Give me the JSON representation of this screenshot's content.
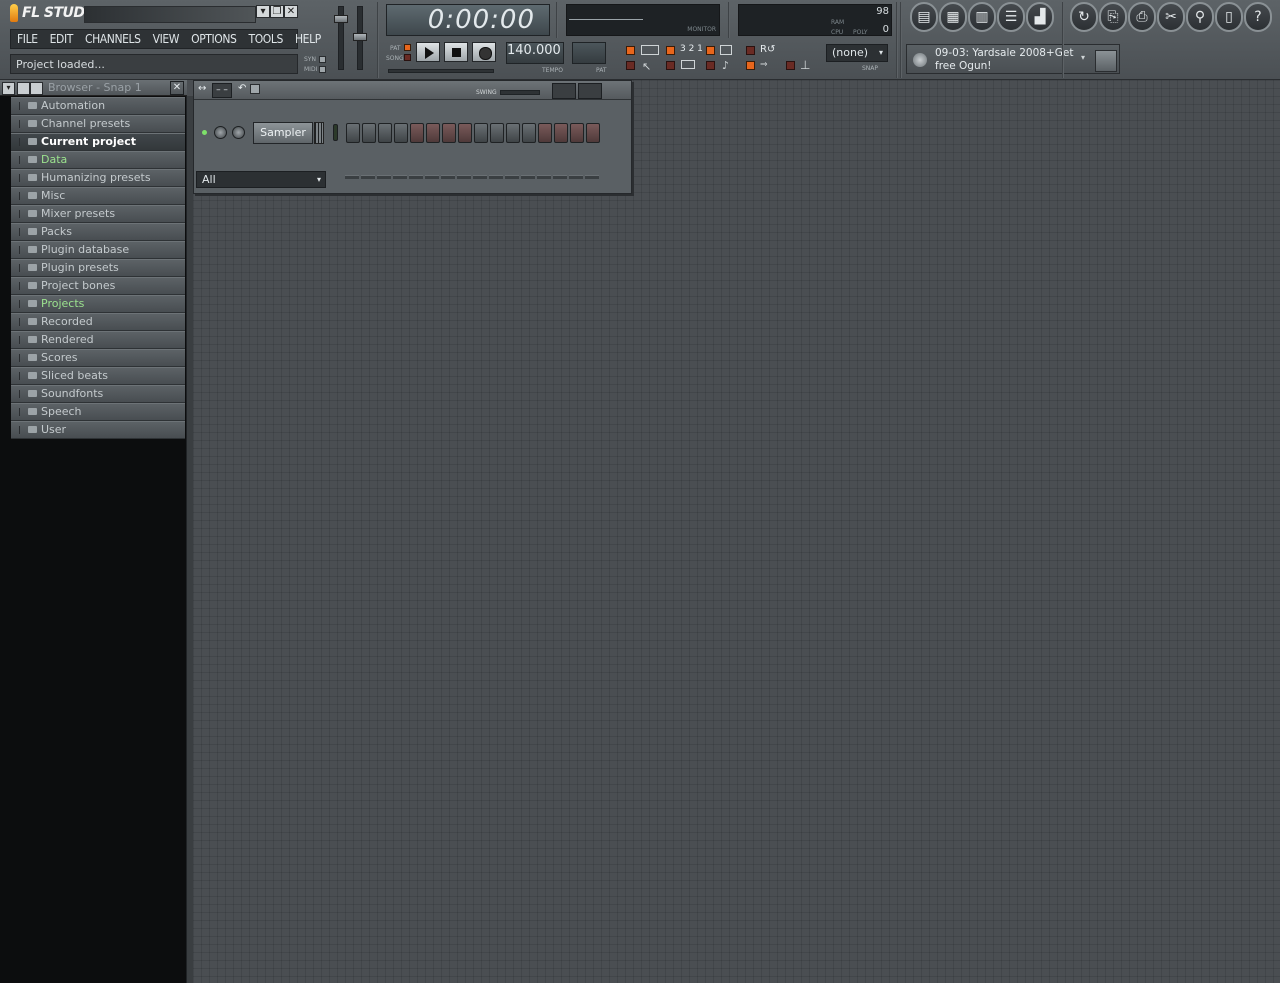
{
  "app": {
    "name": "FL STUDIO",
    "menu": [
      "FILE",
      "EDIT",
      "CHANNELS",
      "VIEW",
      "OPTIONS",
      "TOOLS",
      "HELP"
    ],
    "hint": "Project loaded...",
    "window_buttons": [
      "▾",
      "❐",
      "✕"
    ]
  },
  "transport": {
    "time": "0:00:00",
    "tempo": "140.000",
    "tempo_label": "TEMPO",
    "pat_label": "PAT",
    "mode_labels": [
      "PAT",
      "SONG"
    ],
    "syn_label": "SYN",
    "midi_label": "MIDI",
    "monitor_label": "MONITOR"
  },
  "meters": {
    "ram_label": "RAM",
    "cpu_label": "CPU",
    "poly_label": "POLY",
    "ram_value": "98",
    "poly_value": "0"
  },
  "snap": {
    "value": "(none)",
    "label": "SNAP"
  },
  "news": {
    "text_line1": "09-03: Yardsale 2008+Get",
    "text_line2": "free Ogun!"
  },
  "browser": {
    "title": "Browser - Snap 1",
    "items": [
      {
        "label": "Automation",
        "state": "normal"
      },
      {
        "label": "Channel presets",
        "state": "normal"
      },
      {
        "label": "Current project",
        "state": "selected"
      },
      {
        "label": "Data",
        "state": "green"
      },
      {
        "label": "Humanizing presets",
        "state": "normal"
      },
      {
        "label": "Misc",
        "state": "normal"
      },
      {
        "label": "Mixer presets",
        "state": "normal"
      },
      {
        "label": "Packs",
        "state": "normal"
      },
      {
        "label": "Plugin database",
        "state": "normal"
      },
      {
        "label": "Plugin presets",
        "state": "normal"
      },
      {
        "label": "Project bones",
        "state": "normal"
      },
      {
        "label": "Projects",
        "state": "green"
      },
      {
        "label": "Recorded",
        "state": "normal"
      },
      {
        "label": "Rendered",
        "state": "normal"
      },
      {
        "label": "Scores",
        "state": "normal"
      },
      {
        "label": "Sliced beats",
        "state": "normal"
      },
      {
        "label": "Soundfonts",
        "state": "normal"
      },
      {
        "label": "Speech",
        "state": "normal"
      },
      {
        "label": "User",
        "state": "normal"
      }
    ]
  },
  "step_sequencer": {
    "swing_label": "SWING",
    "channel_name": "Sampler",
    "filter": "All",
    "steps": 16
  },
  "colors": {
    "accent_orange": "#e8661c",
    "green_text": "#9be28e",
    "background": "#4a4e52"
  }
}
